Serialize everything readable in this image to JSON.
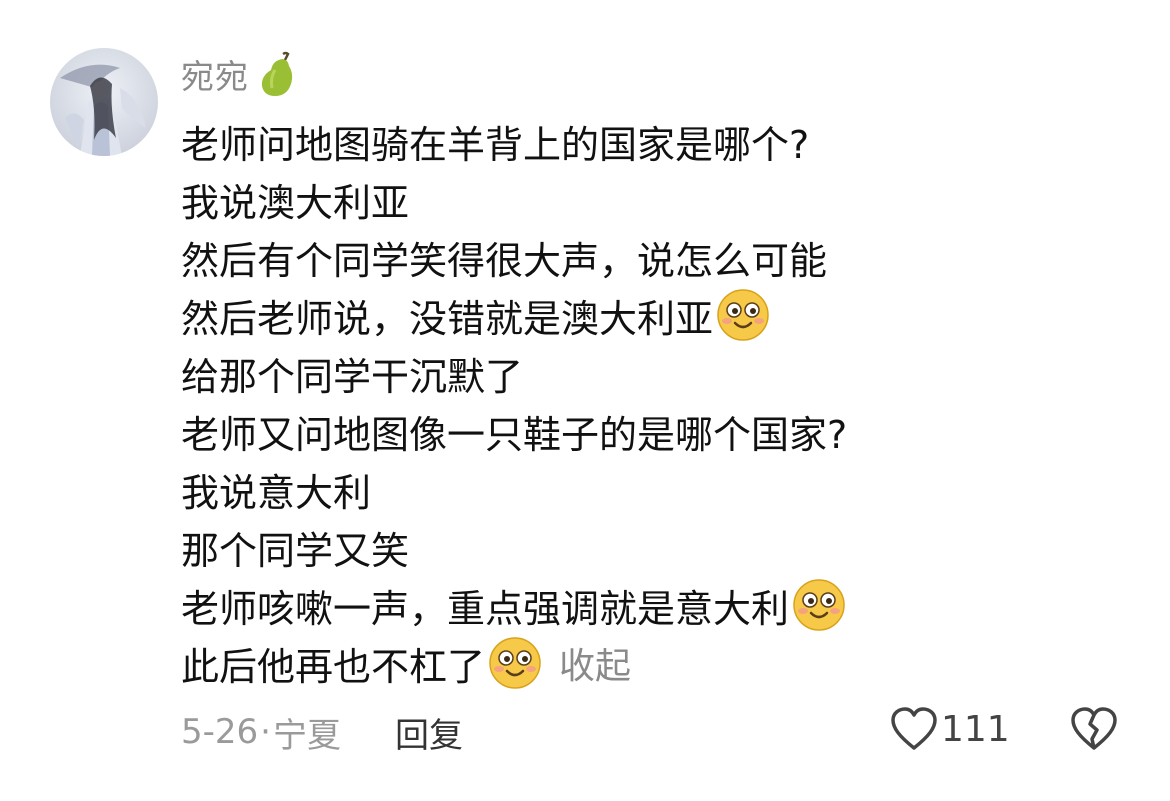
{
  "comment": {
    "username": "宛宛",
    "username_icon": "pear-icon",
    "lines": [
      {
        "text": "老师问地图骑在羊背上的国家是哪个?",
        "emoji": false
      },
      {
        "text": "我说澳大利亚",
        "emoji": false
      },
      {
        "text": "然后有个同学笑得很大声，说怎么可能",
        "emoji": false
      },
      {
        "text": "然后老师说，没错就是澳大利亚",
        "emoji": true
      },
      {
        "text": "给那个同学干沉默了",
        "emoji": false
      },
      {
        "text": "老师又问地图像一只鞋子的是哪个国家?",
        "emoji": false
      },
      {
        "text": "我说意大利",
        "emoji": false
      },
      {
        "text": "那个同学又笑",
        "emoji": false
      },
      {
        "text": "老师咳嗽一声，重点强调就是意大利",
        "emoji": true
      },
      {
        "text": "此后他再也不杠了",
        "emoji": true
      }
    ],
    "emoji_name": "smile-emoji",
    "collapse_label": "收起",
    "date": "5-26",
    "dot": "·",
    "location": "宁夏",
    "reply_label": "回复",
    "like_count": "111",
    "colors": {
      "meta": "#9a9a9a",
      "text": "#111111",
      "emoji_face": "#f7c948"
    }
  }
}
